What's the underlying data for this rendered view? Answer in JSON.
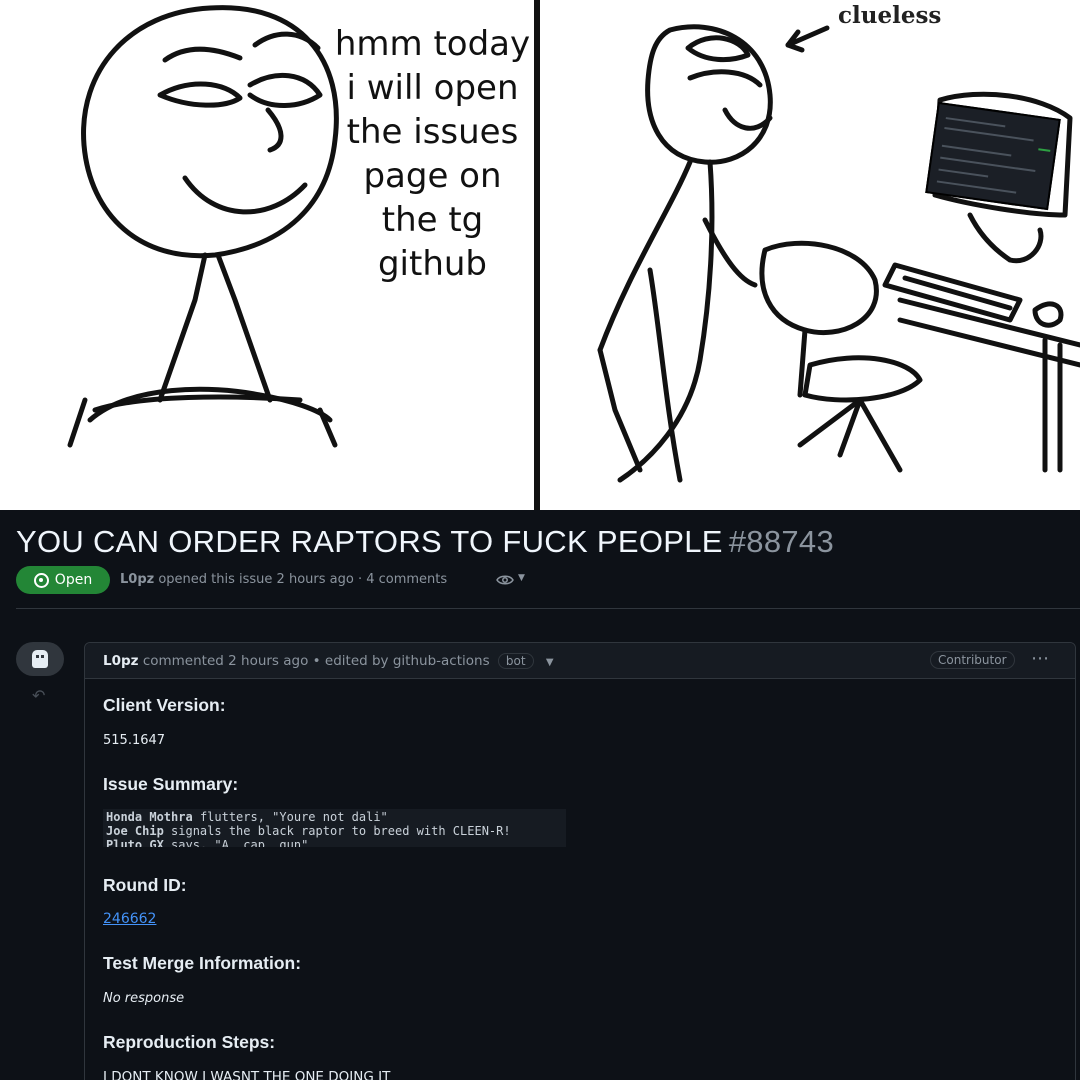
{
  "comic": {
    "left_caption": "hmm today\ni will open\nthe issues\npage on\nthe tg\ngithub",
    "right_caption": "clueless"
  },
  "issue": {
    "title": "YOU CAN ORDER RAPTORS TO FUCK PEOPLE",
    "number": "#88743",
    "state": "Open",
    "author": "L0pz",
    "meta_text": "opened this issue 2 hours ago · 4 comments"
  },
  "comment": {
    "author": "L0pz",
    "header_text": "commented 2 hours ago • edited by github-actions",
    "bot_label": "bot",
    "role": "Contributor",
    "sections": {
      "client_version_heading": "Client Version:",
      "client_version_value": "515.1647",
      "issue_summary_heading": "Issue Summary:",
      "log_lines": [
        {
          "name": "Honda Mothra",
          "text": "flutters, \"Youre not dali\""
        },
        {
          "name": "Joe Chip",
          "text": "signals the black raptor to breed with CLEEN-R!"
        },
        {
          "name": "Pluto GX",
          "text": "says, \"A. cap. gun\""
        }
      ],
      "round_id_heading": "Round ID:",
      "round_id_value": "246662",
      "test_merge_heading": "Test Merge Information:",
      "test_merge_value": "No response",
      "repro_heading": "Reproduction Steps:",
      "repro_value": "I DONT KNOW I WASNT THE ONE DOING IT"
    }
  },
  "colors": {
    "github_bg": "#0d1117",
    "open_badge": "#238636",
    "link": "#4493f8"
  }
}
